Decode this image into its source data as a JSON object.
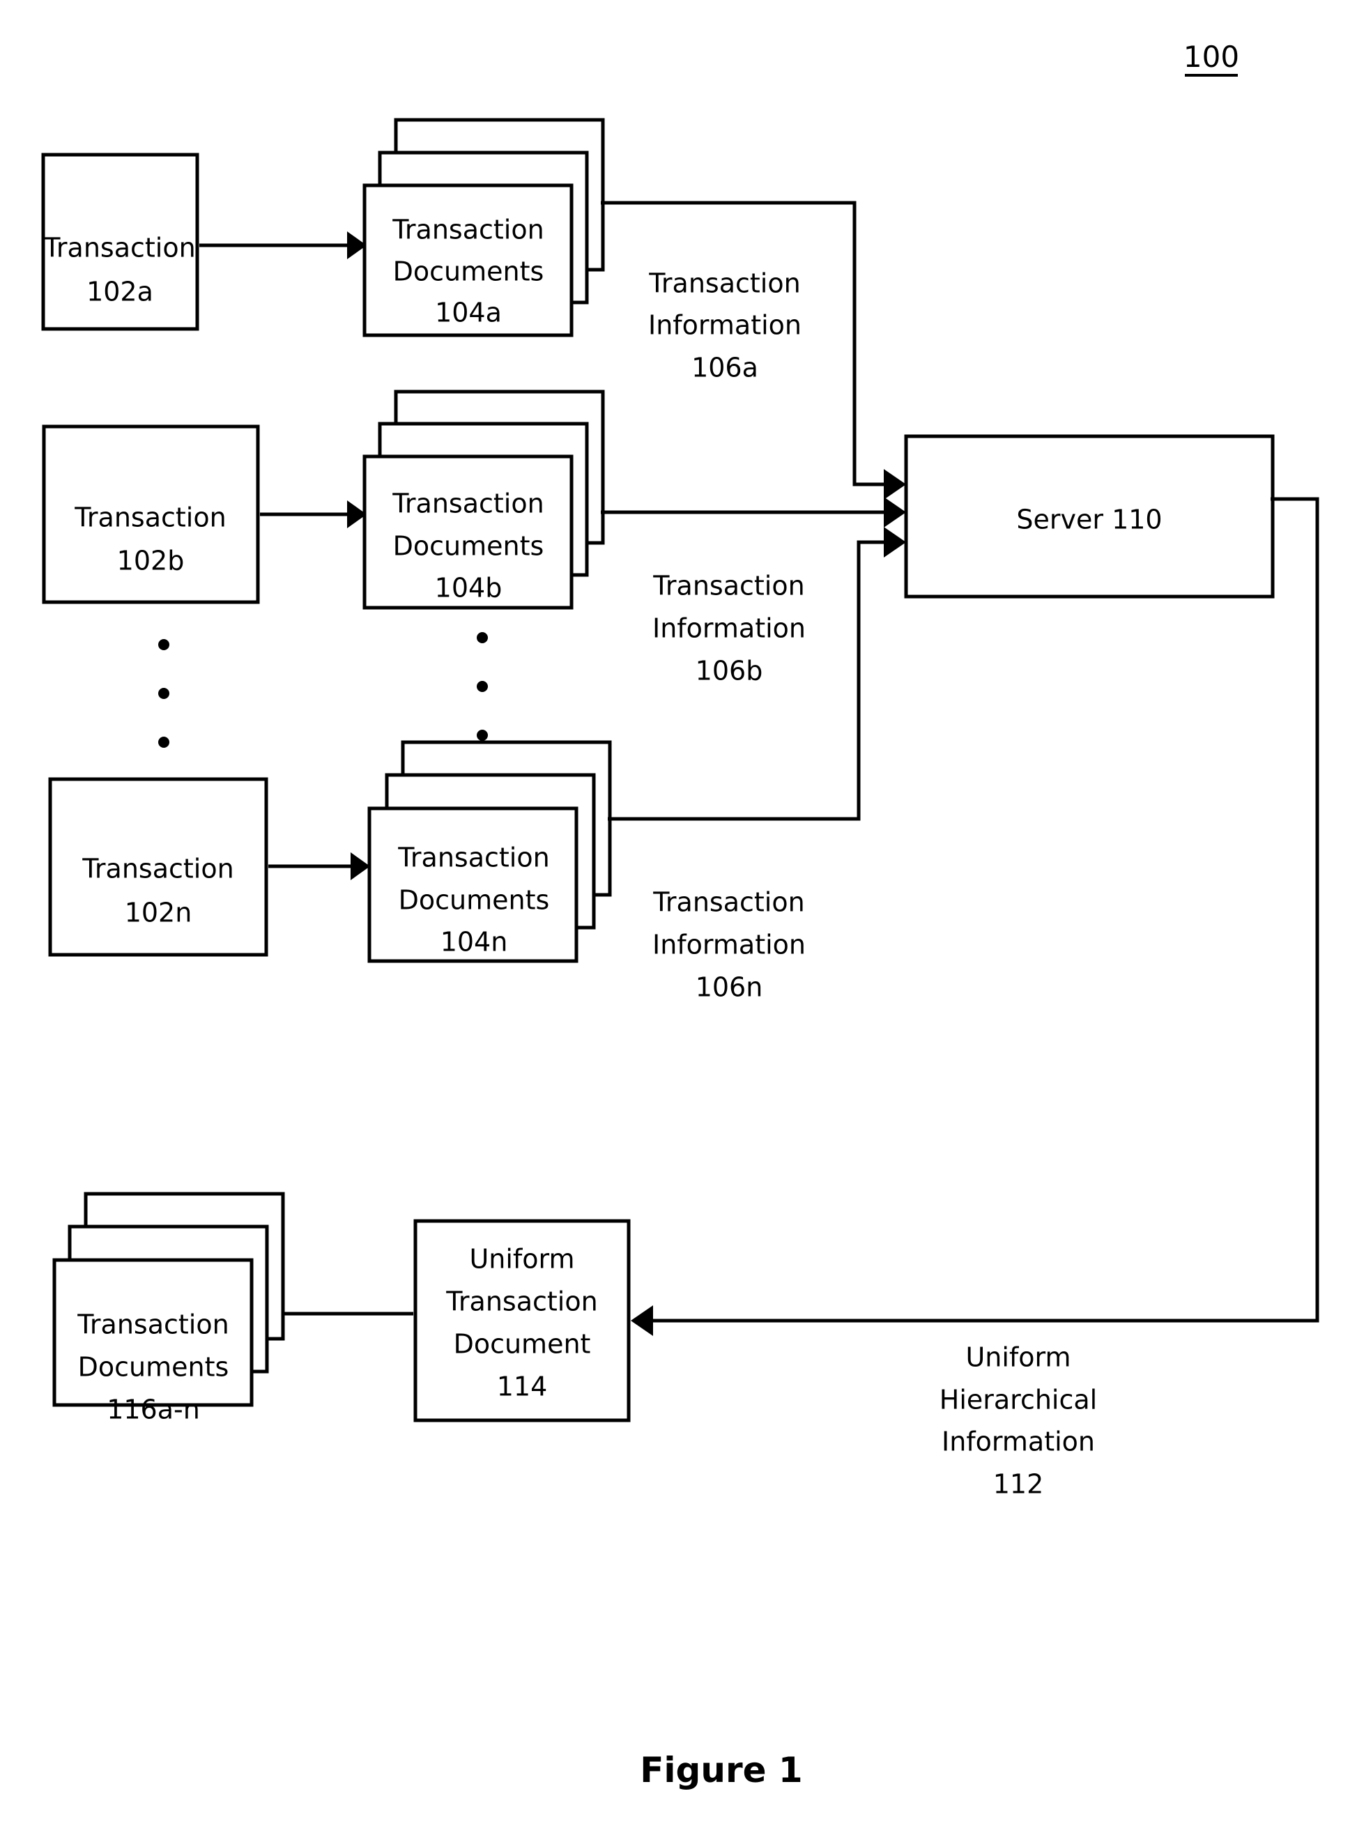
{
  "figure": {
    "reference_numeral": "100",
    "caption": "Figure 1"
  },
  "nodes": {
    "transaction_a": {
      "line1": "Transaction",
      "line2": "102a"
    },
    "transaction_b": {
      "line1": "Transaction",
      "line2": "102b"
    },
    "transaction_n": {
      "line1": "Transaction",
      "line2": "102n"
    },
    "documents_a": {
      "line1": "Transaction",
      "line2": "Documents",
      "line3": "104a"
    },
    "documents_b": {
      "line1": "Transaction",
      "line2": "Documents",
      "line3": "104b"
    },
    "documents_n": {
      "line1": "Transaction",
      "line2": "Documents",
      "line3": "104n"
    },
    "server": {
      "line1": "Server 110"
    },
    "uniform_transaction_document": {
      "line1": "Uniform",
      "line2": "Transaction",
      "line3": "Document",
      "line4": "114"
    },
    "output_documents": {
      "line1": "Transaction",
      "line2": "Documents",
      "line3": "116a-n"
    }
  },
  "edge_labels": {
    "transaction_information_a": {
      "line1": "Transaction",
      "line2": "Information",
      "line3": "106a"
    },
    "transaction_information_b": {
      "line1": "Transaction",
      "line2": "Information",
      "line3": "106b"
    },
    "transaction_information_n": {
      "line1": "Transaction",
      "line2": "Information",
      "line3": "106n"
    },
    "uniform_hierarchical_information": {
      "line1": "Uniform",
      "line2": "Hierarchical",
      "line3": "Information",
      "line4": "112"
    }
  },
  "ellipsis": {
    "transactions_column": "·",
    "documents_column": "·"
  }
}
